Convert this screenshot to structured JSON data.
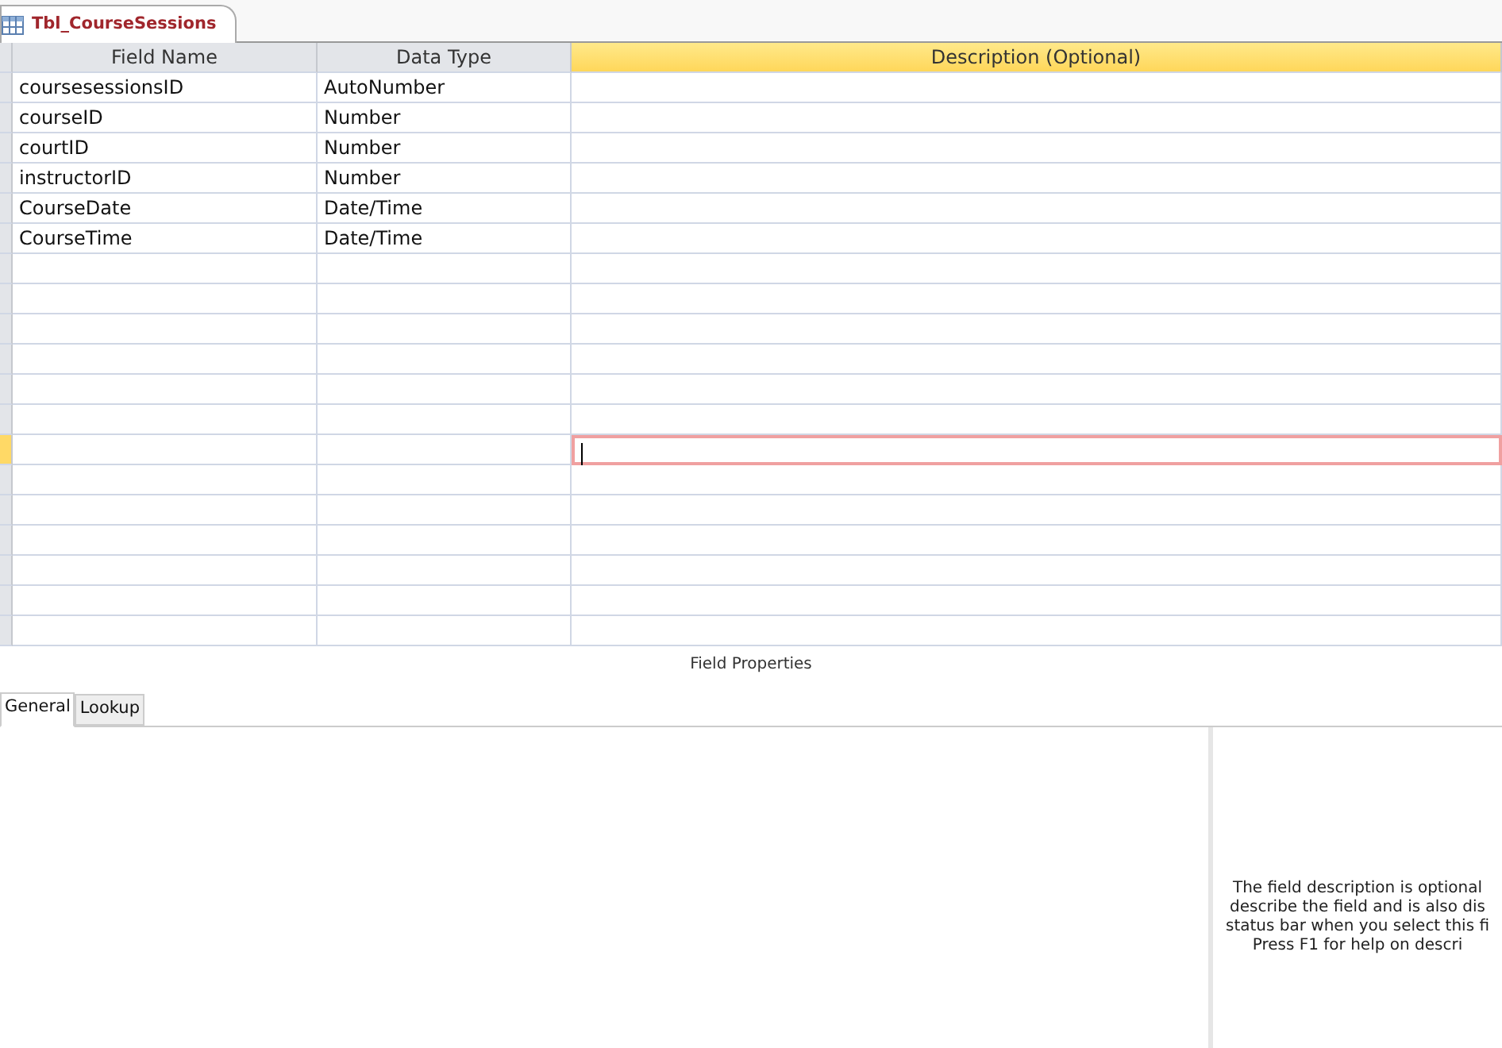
{
  "document_tab": {
    "title": "Tbl_CourseSessions"
  },
  "table": {
    "columns": [
      {
        "label": "Field Name",
        "highlighted": false
      },
      {
        "label": "Data Type",
        "highlighted": false
      },
      {
        "label": "Description (Optional)",
        "highlighted": true
      }
    ],
    "rows": [
      {
        "field_name": "coursesessionsID",
        "data_type": "AutoNumber",
        "selected": false
      },
      {
        "field_name": "courseID",
        "data_type": "Number",
        "selected": false
      },
      {
        "field_name": "courtID",
        "data_type": "Number",
        "selected": false
      },
      {
        "field_name": "instructorID",
        "data_type": "Number",
        "selected": false
      },
      {
        "field_name": "CourseDate",
        "data_type": "Date/Time",
        "selected": false
      },
      {
        "field_name": "CourseTime",
        "data_type": "Date/Time",
        "selected": false
      },
      {
        "selected": false
      },
      {
        "selected": false
      },
      {
        "selected": false
      },
      {
        "selected": false
      },
      {
        "selected": false
      },
      {
        "selected": false
      },
      {
        "selected": true
      },
      {
        "selected": false
      },
      {
        "selected": false
      },
      {
        "selected": false
      },
      {
        "selected": false
      },
      {
        "selected": false
      },
      {
        "selected": false
      }
    ]
  },
  "field_properties": {
    "title": "Field Properties",
    "tabs": [
      {
        "label": "General",
        "selected": true
      },
      {
        "label": "Lookup",
        "selected": false
      }
    ],
    "help_lines": [
      "The field description is optional",
      "describe the field and is also dis",
      "status bar when you select this fi",
      "Press F1 for help on descri"
    ]
  }
}
